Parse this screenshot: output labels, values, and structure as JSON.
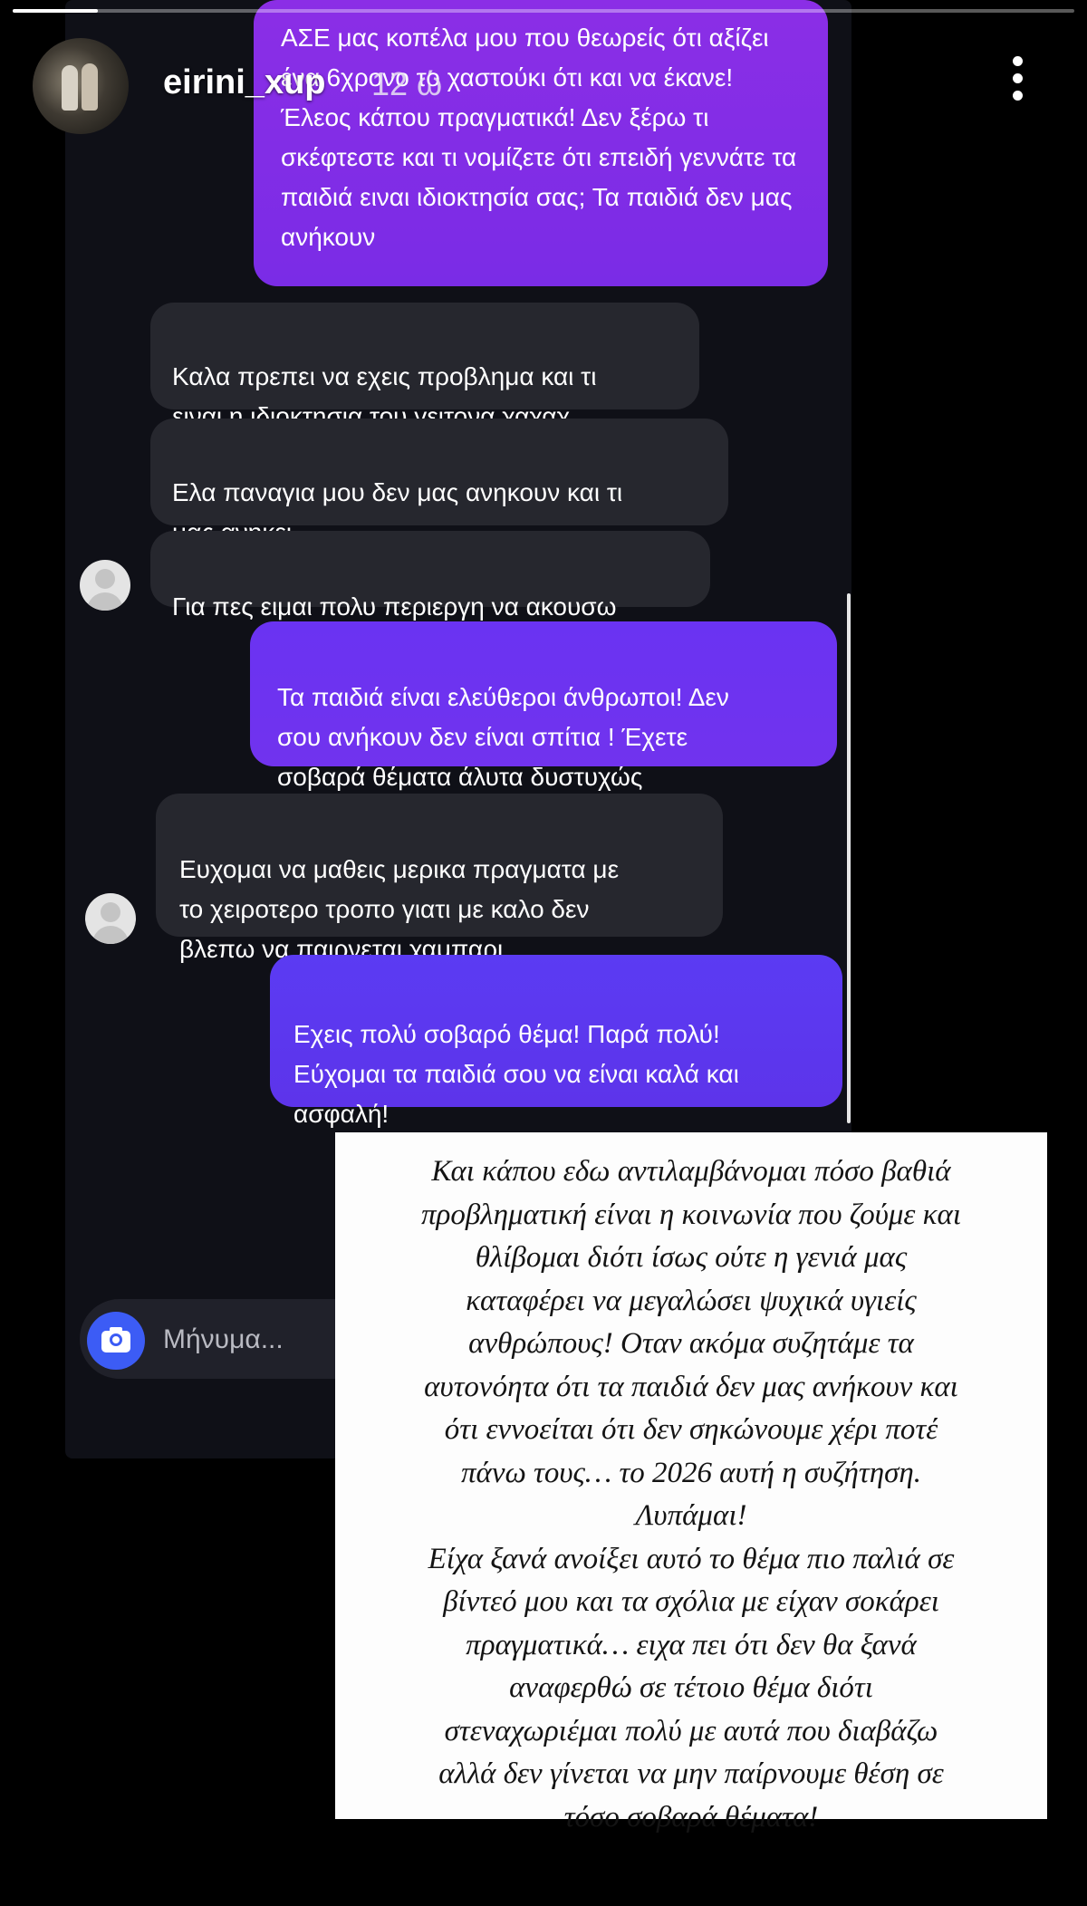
{
  "story": {
    "progress": 0.08,
    "username": "eirini_xup",
    "timestamp": "12 ώ"
  },
  "thread": {
    "messages": [
      {
        "from": "me",
        "text": "ΑΣΕ μας κοπέλα μου που θεωρείς ότι αξίζει ένα 6χρονο το χαστούκι ότι και να έκανε! Έλεος κάπου πραγματικά! Δεν ξέρω τι σκέφτεστε και τι νομίζετε ότι επειδή γεννάτε τα παιδιά ειναι ιδιοκτησία σας; Τα παιδιά δεν μας ανήκουν"
      },
      {
        "from": "them",
        "text": "Καλα πρεπει να εχεις προβλημα και τι\nειναι η ιδιοκτησια του γειτονα χαχαχ"
      },
      {
        "from": "them",
        "text": "Ελα παναγια μου δεν μας ανηκουν και τι\nμας ανηκει"
      },
      {
        "from": "them",
        "text": "Για πες ειμαι πολυ περιεργη να ακουσω"
      },
      {
        "from": "me",
        "text": "Τα παιδιά είναι ελεύθεροι άνθρωποι! Δεν\nσου ανήκουν δεν είναι σπίτια ! Έχετε\nσοβαρά θέματα άλυτα δυστυχώς"
      },
      {
        "from": "them",
        "text": "Ευχομαι να μαθεις μερικα πραγματα με\nτο χειροτερο τροπο γιατι με καλο δεν\nβλεπω να παιρνεται χαμπαρι"
      },
      {
        "from": "me",
        "text": "Εχεις πολύ σοβαρό θέμα! Παρά πολύ!\nΕύχομαι τα παιδιά σου να είναι καλά και\nασφαλή!"
      }
    ],
    "composer_placeholder": "Μήνυμα..."
  },
  "caption": "Και κάπου εδω αντιλαμβάνομαι πόσο βαθιά\nπροβληματική είναι η κοινωνία που ζούμε και\nθλίβομαι διότι ίσως ούτε η γενιά μας\nκαταφέρει να μεγαλώσει ψυχικά υγιείς\nανθρώπους! Οταν ακόμα συζητάμε τα\nαυτονόητα ότι τα παιδιά δεν μας ανήκουν και\nότι εννοείται ότι δεν σηκώνουμε χέρι ποτέ\nπάνω τους… το 2026 αυτή η συζήτηση.\nΛυπάμαι!\nΕίχα ξανά ανοίξει αυτό το θέμα πιο παλιά σε\nβίντεό μου και τα σχόλια με είχαν σοκάρει\nπραγματικά… ειχα πει ότι δεν θα ξανά\nαναφερθώ σε τέτοιο θέμα διότι\nστεναχωριέμαι πολύ με αυτά που διαβάζω\nαλλά δεν γίνεται να μην παίρνουμε θέση σε\nτόσο σοβαρά θέματα!"
}
